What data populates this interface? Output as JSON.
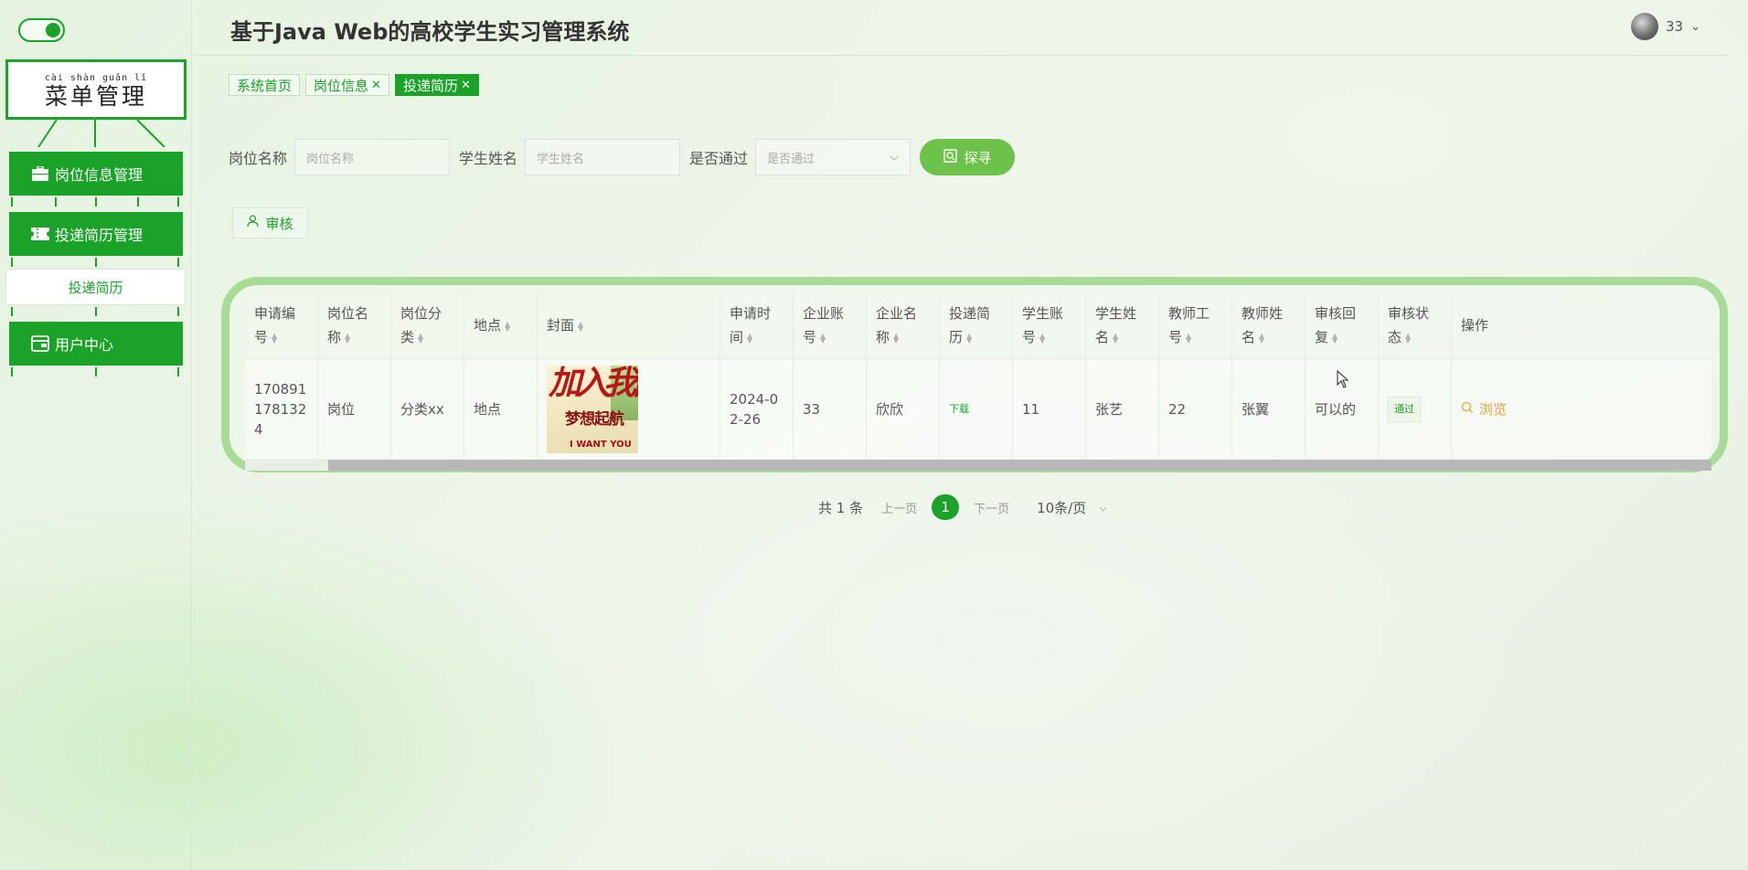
{
  "app": {
    "title": "基于Java Web的高校学生实习管理系统"
  },
  "user": {
    "name": "33",
    "caret": "⌄"
  },
  "sidebar": {
    "menu_title_pinyin": "cài shàn guǎn  lǐ",
    "menu_title": "菜单管理",
    "items": [
      {
        "label": "岗位信息管理",
        "icon": "briefcase-icon"
      },
      {
        "label": "投递简历管理",
        "icon": "ticket-icon"
      },
      {
        "label": "投递简历",
        "icon": ""
      },
      {
        "label": "用户中心",
        "icon": "wallet-icon"
      }
    ]
  },
  "tabs": [
    {
      "label": "系统首页",
      "closable": false,
      "active": false
    },
    {
      "label": "岗位信息",
      "closable": true,
      "active": false
    },
    {
      "label": "投递简历",
      "closable": true,
      "active": true
    }
  ],
  "tab_close": "✕",
  "search": {
    "job_label": "岗位名称",
    "job_placeholder": "岗位名称",
    "student_label": "学生姓名",
    "student_placeholder": "学生姓名",
    "passed_label": "是否通过",
    "passed_placeholder": "是否通过",
    "button": "探寻"
  },
  "audit_button": "审核",
  "table": {
    "headers": [
      "申请编号",
      "岗位名称",
      "岗位分类",
      "地点",
      "封面",
      "申请时间",
      "企业账号",
      "企业名称",
      "投递简历",
      "学生账号",
      "学生姓名",
      "教师工号",
      "教师姓名",
      "审核回复",
      "审核状态",
      "操作"
    ],
    "headers_wrapped": [
      [
        "申请编",
        "号"
      ],
      [
        "岗位名",
        "称"
      ],
      [
        "岗位分",
        "类"
      ],
      [
        "地点",
        ""
      ],
      [
        "封面",
        ""
      ],
      [
        "申请时",
        "间"
      ],
      [
        "企业账",
        "号"
      ],
      [
        "企业名",
        "称"
      ],
      [
        "投递简",
        "历"
      ],
      [
        "学生账",
        "号"
      ],
      [
        "学生姓",
        "名"
      ],
      [
        "教师工",
        "号"
      ],
      [
        "教师姓",
        "名"
      ],
      [
        "审核回",
        "复"
      ],
      [
        "审核状",
        "态"
      ],
      [
        "操作",
        ""
      ]
    ],
    "row": {
      "id_lines": [
        "170891",
        "178132",
        "4"
      ],
      "job": "岗位",
      "category": "分类xx",
      "place": "地点",
      "cover_text_main": "加入我们",
      "cover_text_sub": "梦想起航",
      "cover_text_en": "I WANT YOU",
      "date_lines": [
        "2024-0",
        "2-26"
      ],
      "company_account": "33",
      "company_name": "欣欣",
      "resume_link": "下载",
      "student_account": "11",
      "student_name": "张艺",
      "teacher_id": "22",
      "teacher_name": "张翼",
      "reply": "可以的",
      "status": "通过",
      "action": "浏览"
    }
  },
  "pagination": {
    "total": "共 1 条",
    "prev": "上一页",
    "current": "1",
    "next": "下一页",
    "page_size": "10条/页"
  },
  "colors": {
    "primary": "#1aa229",
    "search_button": "#6cc24a",
    "table_border": "#a8db98",
    "action": "#e6a23c"
  }
}
